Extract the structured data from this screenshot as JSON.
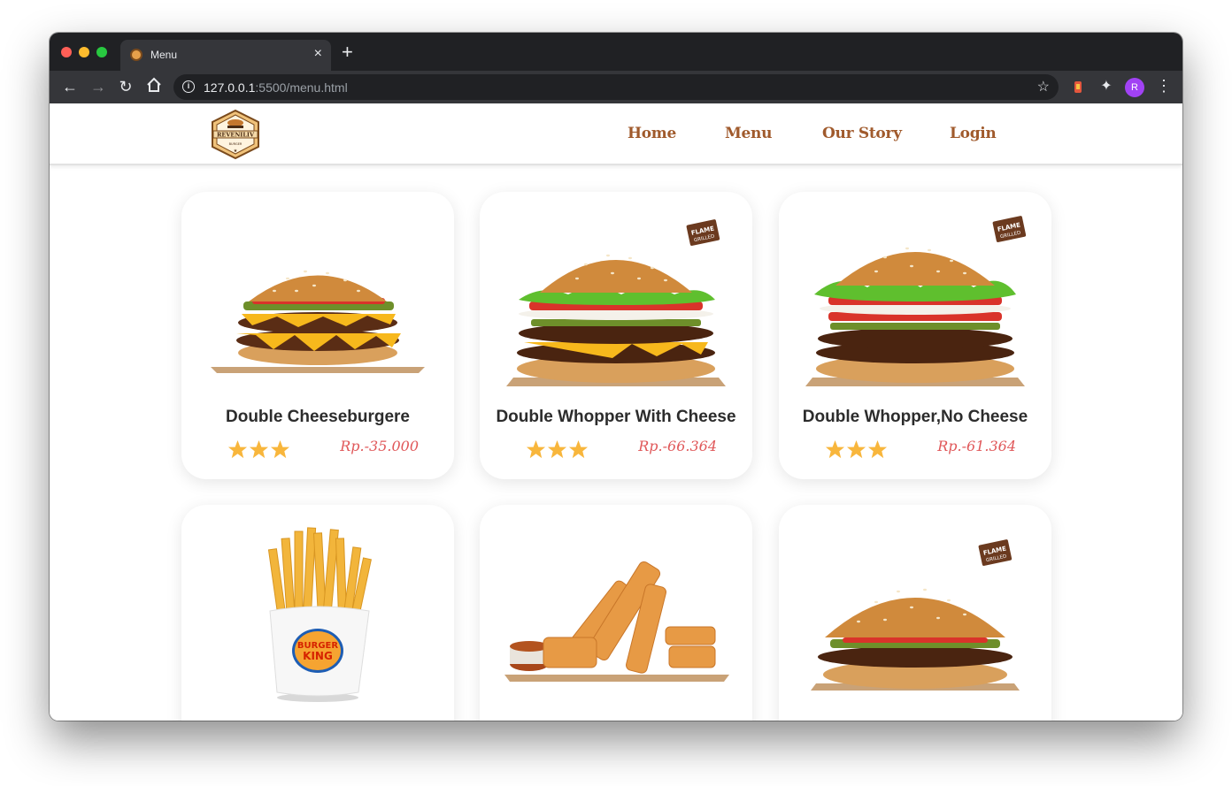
{
  "browser": {
    "tab_title": "Menu",
    "tab_close": "×",
    "new_tab": "+",
    "url_host": "127.0.0.1",
    "url_rest": ":5500/menu.html",
    "avatar_letter": "R"
  },
  "site": {
    "logo_text": "REVENILIV",
    "logo_sub": "BURGER",
    "nav": [
      "Home",
      "Menu",
      "Our Story",
      "Login"
    ],
    "accent_color": "#a05a2c",
    "price_color": "#e0585a"
  },
  "menu": [
    {
      "name": "Double Cheeseburgere",
      "price": "Rp.-35.000",
      "rating": 3,
      "image": "cheeseburger",
      "flame_grilled": false
    },
    {
      "name": "Double Whopper With Cheese",
      "price": "Rp.-66.364",
      "rating": 3,
      "image": "whopper-cheese",
      "flame_grilled": true
    },
    {
      "name": "Double Whopper,No Cheese",
      "price": "Rp.-61.364",
      "rating": 3,
      "image": "whopper-no-cheese",
      "flame_grilled": true
    },
    {
      "name": "",
      "price": "",
      "rating": 0,
      "image": "fries",
      "flame_grilled": false
    },
    {
      "name": "",
      "price": "",
      "rating": 0,
      "image": "cheese-sticks",
      "flame_grilled": false
    },
    {
      "name": "",
      "price": "",
      "rating": 0,
      "image": "whopper",
      "flame_grilled": true
    }
  ],
  "labels": {
    "flame_grilled": "FLAME GRILLED",
    "fries_brand": "BURGER KING"
  }
}
